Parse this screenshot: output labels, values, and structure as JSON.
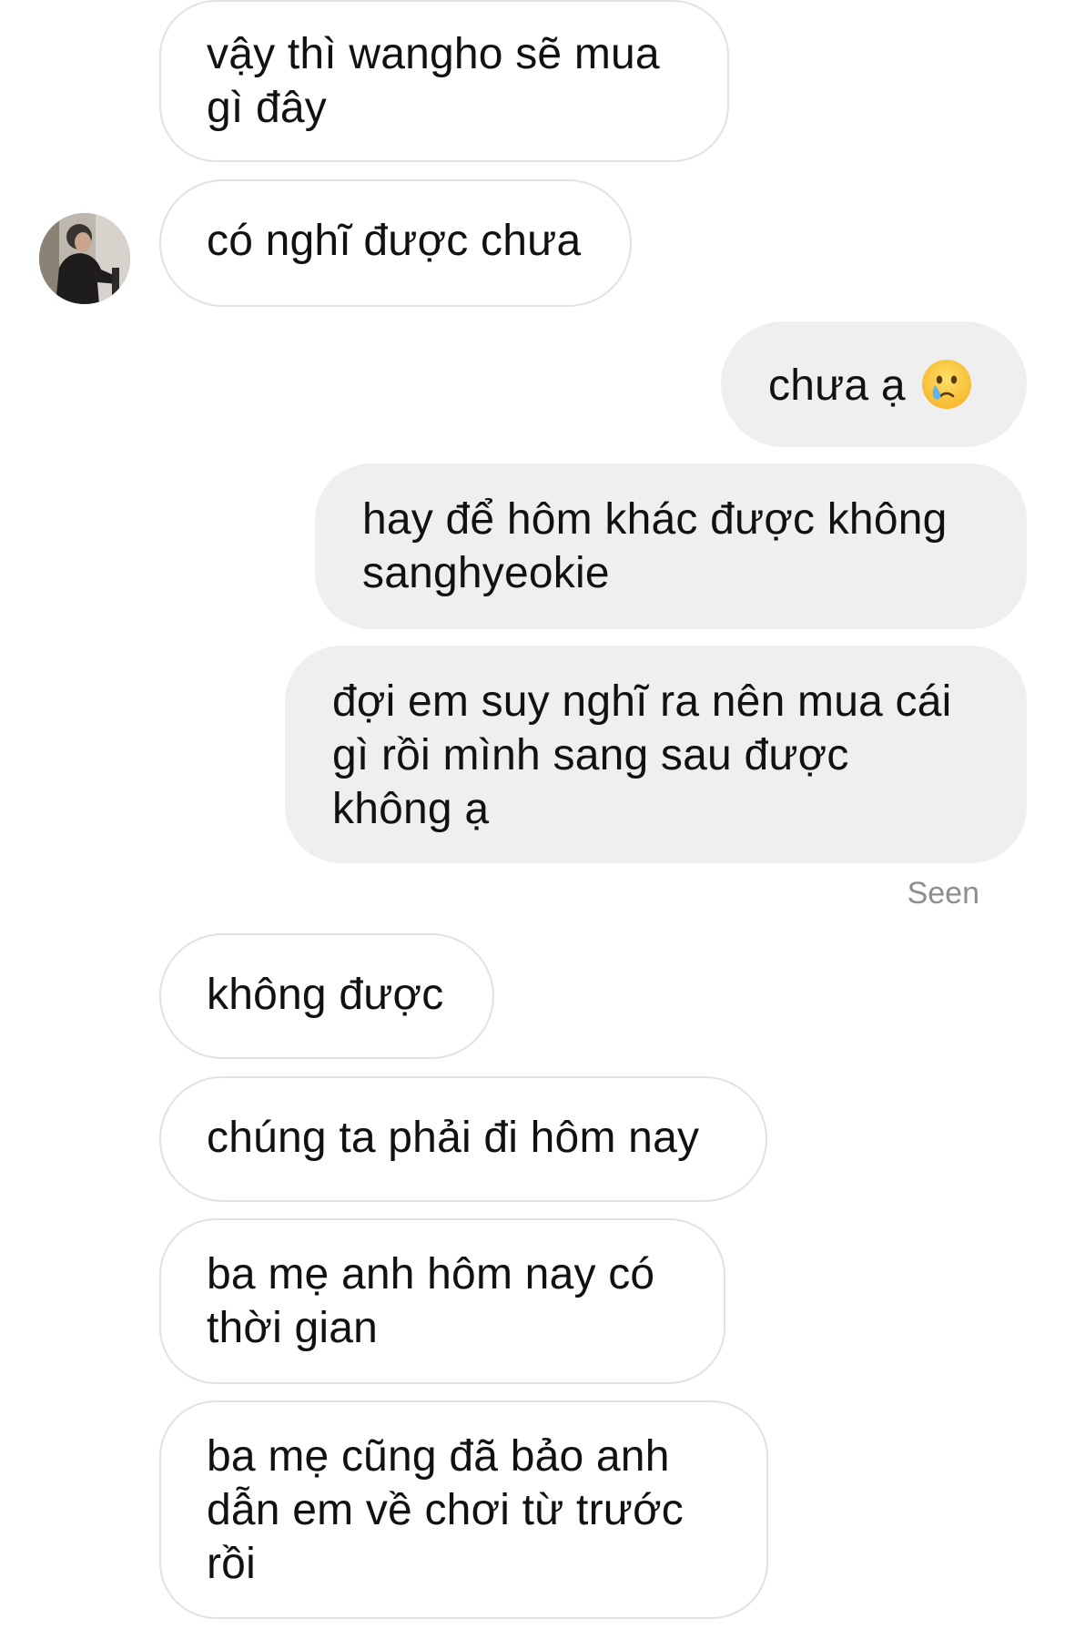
{
  "conversation": {
    "messages": [
      {
        "side": "incoming",
        "lines": [
          "vậy thì wangho sẽ mua",
          "gì đây"
        ]
      },
      {
        "side": "incoming",
        "lines": [
          "có nghĩ được chưa"
        ]
      },
      {
        "side": "outgoing",
        "lines": [
          "chưa ạ"
        ],
        "emoji": "crying-face-emoji"
      },
      {
        "side": "outgoing",
        "lines": [
          "hay để hôm khác được không",
          "sanghyeokie"
        ]
      },
      {
        "side": "outgoing",
        "lines": [
          "đợi em suy nghĩ ra nên mua cái",
          "gì rồi mình sang sau được",
          "không ạ"
        ]
      },
      {
        "side": "incoming",
        "lines": [
          "không được"
        ]
      },
      {
        "side": "incoming",
        "lines": [
          "chúng ta phải đi hôm nay"
        ]
      },
      {
        "side": "incoming",
        "lines": [
          "ba mẹ anh hôm nay có",
          "thời gian"
        ]
      },
      {
        "side": "incoming",
        "lines": [
          "ba mẹ cũng đã bảo anh",
          "dẫn em về chơi từ trước",
          "rồi"
        ]
      }
    ],
    "seen_label": "Seen"
  },
  "icons": {
    "avatar": "contact-avatar",
    "emoji": "crying-face-emoji"
  },
  "colors": {
    "incoming_bg": "#ffffff",
    "incoming_border": "#e2e2e2",
    "outgoing_bg": "#efefef",
    "text": "#111111",
    "seen_text": "#8e8e8e"
  }
}
